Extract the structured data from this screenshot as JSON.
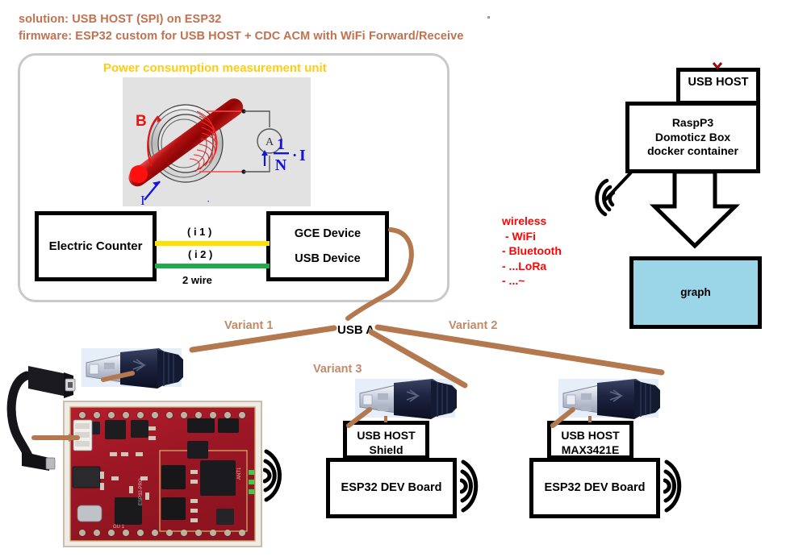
{
  "header": {
    "line1": "solution:  USB HOST (SPI) on ESP32",
    "line2": "firmware: ESP32 custom for USB HOST + CDC ACM with WiFi Forward/Receive",
    "color": "#c2714f"
  },
  "panel": {
    "title": "Power consumption measurement unit",
    "title_color": "#ffcc10",
    "ct_diagram": {
      "field_label": "B",
      "current_label": "I",
      "meter_label": "A",
      "ratio_numerator": "1",
      "ratio_denominator": "N",
      "ratio_suffix": "· I"
    },
    "electric_counter": {
      "label": "Electric Counter"
    },
    "gce_device": {
      "line1": "GCE Device",
      "line2": "USB Device"
    },
    "wires": {
      "wire1_label": "( i 1 )",
      "wire1_color": "#ffe000",
      "wire2_label": "( i 2 )",
      "wire2_color": "#1faa4b",
      "bus_label": "2 wire"
    }
  },
  "right": {
    "usb_host_top": {
      "label": "USB HOST"
    },
    "rasp_box": {
      "line1": "RaspP3",
      "line2": "Domoticz Box",
      "line3": "docker container"
    },
    "graph_box": {
      "label": "graph",
      "fill": "#9ad6e8"
    },
    "wireless": {
      "title": "wireless",
      "items": [
        "- WiFi",
        "- Bluetooth",
        "- ...LoRa",
        "- ...~"
      ],
      "color": "#fb0505"
    }
  },
  "bottom": {
    "usb_a_label": "USB A",
    "variants": [
      {
        "label": "Variant 1"
      },
      {
        "label": "Variant 2"
      },
      {
        "label": "Variant 3"
      }
    ],
    "variant_color": "#c08b68",
    "branch3": {
      "host_line1": "USB HOST",
      "host_line2": "Shield",
      "board_label": "ESP32 DEV Board"
    },
    "branch2": {
      "host_line1": "USB HOST",
      "host_line2": "MAX3421E",
      "board_label": "ESP32 DEV Board"
    }
  }
}
